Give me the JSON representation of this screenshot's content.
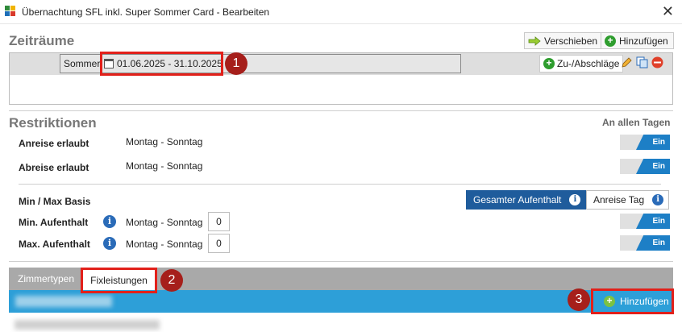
{
  "window": {
    "title": "Übernachtung SFL inkl. Super Sommer Card - Bearbeiten",
    "close_symbol": "✕"
  },
  "zeitraeume": {
    "heading": "Zeiträume",
    "move_label": "Verschieben",
    "add_label": "Hinzufügen",
    "period": {
      "name": "Sommer",
      "dates": "01.06.2025 - 31.10.2025"
    },
    "surcharge_label": "Zu-/Abschläge"
  },
  "restriktionen": {
    "heading": "Restriktionen",
    "scope_label": "An allen Tagen",
    "toggle_label": "Ein",
    "rows": [
      {
        "label": "Anreise erlaubt",
        "value": "Montag - Sonntag"
      },
      {
        "label": "Abreise erlaubt",
        "value": "Montag - Sonntag"
      }
    ],
    "minmax_label": "Min / Max Basis",
    "basis_options": [
      "Gesamter Aufenthalt",
      "Anreise Tag"
    ],
    "basis_selected": "Gesamter Aufenthalt",
    "stay_rows": [
      {
        "label": "Min. Aufenthalt",
        "value": "Montag - Sonntag",
        "number": "0"
      },
      {
        "label": "Max. Aufenthalt",
        "value": "Montag - Sonntag",
        "number": "0"
      }
    ]
  },
  "tabs": {
    "items": [
      "Zimmertypen",
      "Fixleistungen"
    ],
    "active": "Fixleistungen"
  },
  "list": {
    "add_label": "Hinzufügen"
  },
  "annotations": [
    "1",
    "2",
    "3"
  ],
  "colors": {
    "accent_blue": "#1f5c9c",
    "list_header": "#2d9fd8",
    "toggle_on": "#1d7fc6",
    "add_green": "#2e9d2e",
    "annotation_red": "#e2201a"
  }
}
